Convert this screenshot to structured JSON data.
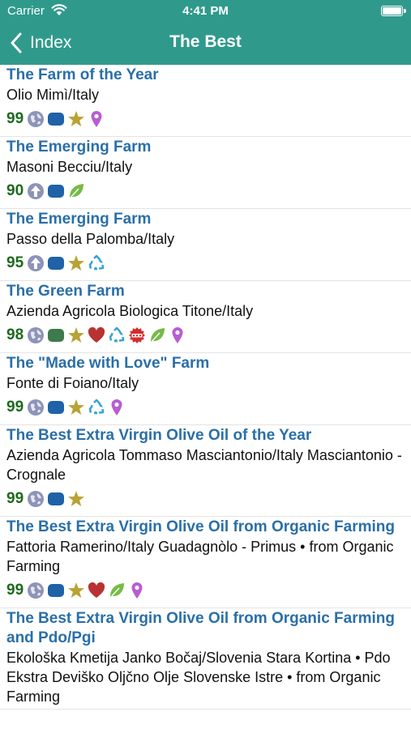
{
  "status": {
    "carrier": "Carrier",
    "time": "4:41 PM"
  },
  "nav": {
    "back_label": "Index",
    "title": "The Best"
  },
  "colors": {
    "nav": "#2f9a8c",
    "title": "#2a6fa8",
    "score": "#1d6b1d"
  },
  "items": [
    {
      "title": "The Farm of the Year",
      "subtitle": "Olio Mimì/Italy",
      "score": "99",
      "icons": [
        "globe-icon",
        "container-icon",
        "star-icon",
        "location-pin-icon"
      ]
    },
    {
      "title": "The Emerging Farm",
      "subtitle": "Masoni Becciu/Italy",
      "score": "90",
      "icons": [
        "up-arrow-icon",
        "container-icon",
        "leaf-icon"
      ]
    },
    {
      "title": "The Emerging Farm",
      "subtitle": "Passo della Palomba/Italy",
      "score": "95",
      "icons": [
        "up-arrow-icon",
        "container-icon",
        "star-icon",
        "recycle-icon"
      ]
    },
    {
      "title": "The Green Farm",
      "subtitle": "Azienda Agricola Biologica Titone/Italy",
      "score": "98",
      "icons": [
        "globe-icon",
        "green-container-icon",
        "star-icon",
        "heart-icon",
        "recycle-icon",
        "dop-badge-icon",
        "leaf-icon",
        "location-pin-icon"
      ]
    },
    {
      "title": "The \"Made with Love\" Farm",
      "subtitle": "Fonte di Foiano/Italy",
      "score": "99",
      "icons": [
        "globe-icon",
        "container-icon",
        "star-icon",
        "recycle-icon",
        "location-pin-icon"
      ]
    },
    {
      "title": "The Best Extra Virgin Olive Oil of the Year",
      "subtitle": "Azienda Agricola Tommaso Masciantonio/Italy Masciantonio - Crognale",
      "score": "99",
      "icons": [
        "globe-icon",
        "container-icon",
        "star-icon"
      ]
    },
    {
      "title": "The Best Extra Virgin Olive Oil from Organic Farming",
      "subtitle": "Fattoria Ramerino/Italy Guadagnòlo - Primus • from Organic Farming",
      "score": "99",
      "icons": [
        "globe-icon",
        "container-icon",
        "star-icon",
        "heart-icon",
        "leaf-icon",
        "location-pin-icon"
      ]
    },
    {
      "title": "The Best Extra Virgin Olive Oil from Organic Farming and Pdo/Pgi",
      "subtitle": "Ekološka Kmetija Janko Bočaj/Slovenia Stara Kortina • Pdo Ekstra Deviško Oljčno Olje Slovenske Istre • from Organic Farming",
      "score": "",
      "icons": []
    }
  ]
}
